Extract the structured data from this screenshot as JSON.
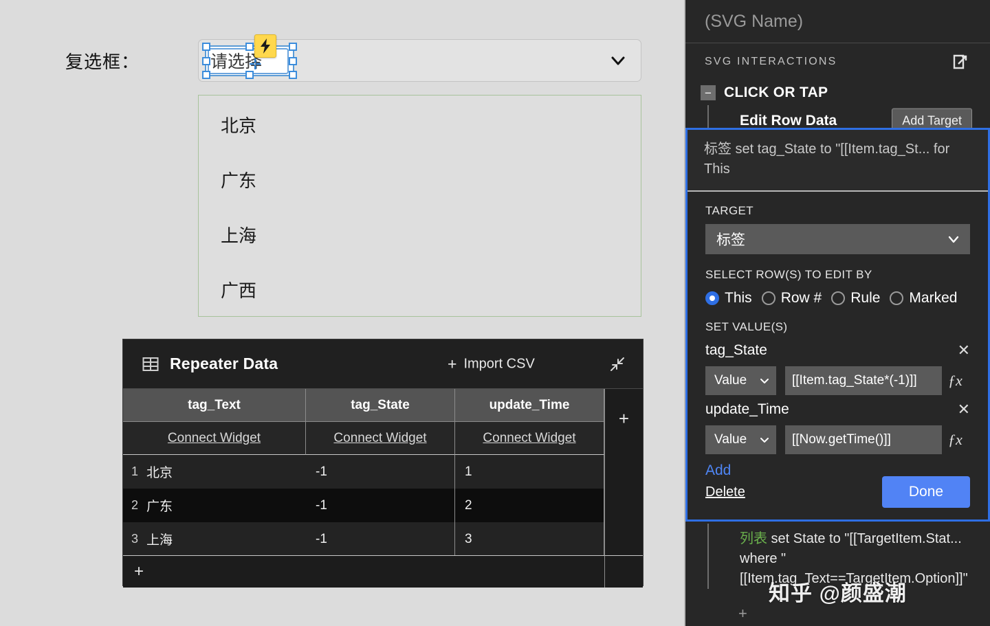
{
  "canvas": {
    "field_label": "复选框：",
    "dropdown": {
      "value": "请选择",
      "chevron_icon": "chevron-down-icon",
      "badge_icon": "lightning-bolt-icon"
    },
    "list_items": [
      "北京",
      "广东",
      "上海",
      "广西"
    ]
  },
  "repeater": {
    "title": "Repeater Data",
    "grid_icon": "table-grid-icon",
    "import_label": "Import CSV",
    "import_plus": "+",
    "collapse_icon": "collapse-arrows-icon",
    "columns": [
      "tag_Text",
      "tag_State",
      "update_Time"
    ],
    "connect_label": "Connect Widget",
    "rows": [
      {
        "index": "1",
        "tag_Text": "北京",
        "tag_State": "-1",
        "update_Time": "1"
      },
      {
        "index": "2",
        "tag_Text": "广东",
        "tag_State": "-1",
        "update_Time": "2"
      },
      {
        "index": "3",
        "tag_Text": "上海",
        "tag_State": "-1",
        "update_Time": "3"
      }
    ],
    "add_column_label": "+",
    "add_row_label": "+"
  },
  "right_panel": {
    "svg_name": "(SVG Name)",
    "section_title": "SVG INTERACTIONS",
    "popout_icon": "open-external-icon",
    "event": {
      "collapse_label": "−",
      "name": "CLICK OR TAP"
    },
    "action": {
      "name": "Edit Row Data",
      "add_target_label": "Add Target"
    },
    "editor": {
      "summary": "标签 set tag_State to \"[[Item.tag_St... for This",
      "target_label": "TARGET",
      "target_value": "标签",
      "target_chevron": "chevron-down-icon",
      "select_rows_label": "SELECT ROW(S) TO EDIT BY",
      "radios": [
        {
          "label": "This",
          "selected": true
        },
        {
          "label": "Row #",
          "selected": false
        },
        {
          "label": "Rule",
          "selected": false
        },
        {
          "label": "Marked",
          "selected": false
        }
      ],
      "set_values_label": "SET VALUE(S)",
      "values": [
        {
          "field": "tag_State",
          "mode": "Value",
          "expression": "[[Item.tag_State*(-1)]]",
          "remove_icon": "close-icon",
          "fx_icon": "fx-icon"
        },
        {
          "field": "update_Time",
          "mode": "Value",
          "expression": "[[Now.getTime()]]",
          "remove_icon": "close-icon",
          "fx_icon": "fx-icon"
        }
      ],
      "add_label": "Add",
      "delete_label": "Delete",
      "done_label": "Done"
    },
    "action2": {
      "target": "列表",
      "text": " set State to \"[[TargetItem.Stat... where \"[[Item.tag_Text==TargetItem.Option]]\""
    },
    "add_action_label": "+"
  },
  "watermark": "知乎 @颜盛潮",
  "colors": {
    "accent_blue": "#2f6fe4",
    "done_blue": "#5183f5",
    "link_blue": "#4f86f5",
    "green_text": "#6ab04c",
    "canvas_bg": "#dcdcdc",
    "panel_bg": "#272727",
    "badge_yellow": "#ffd84d"
  }
}
